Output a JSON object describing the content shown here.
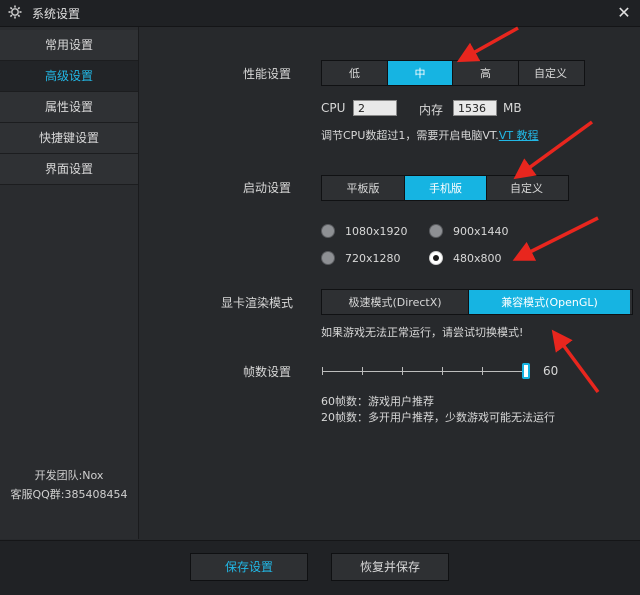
{
  "window": {
    "title": "系统设置",
    "close_glyph": "✕",
    "icon": "gear-icon"
  },
  "sidebar": {
    "items": [
      {
        "label": "常用设置",
        "active": false
      },
      {
        "label": "高级设置",
        "active": true
      },
      {
        "label": "属性设置",
        "active": false
      },
      {
        "label": "快捷键设置",
        "active": false
      },
      {
        "label": "界面设置",
        "active": false
      }
    ],
    "footer": {
      "team": "开发团队:Nox",
      "support": "客服QQ群:385408454"
    }
  },
  "performance": {
    "label": "性能设置",
    "options": [
      "低",
      "中",
      "高",
      "自定义"
    ],
    "selected": "中",
    "cpu_label": "CPU",
    "cpu_value": "2",
    "mem_label": "内存",
    "mem_value": "1536",
    "mem_unit": "MB",
    "hint_prefix": "调节CPU数超过1，需要开启电脑VT.",
    "hint_link": "VT 教程"
  },
  "startup": {
    "label": "启动设置",
    "options": [
      "平板版",
      "手机版",
      "自定义"
    ],
    "selected": "手机版",
    "resolutions": [
      {
        "label": "1080x1920",
        "checked": false
      },
      {
        "label": "900x1440",
        "checked": false
      },
      {
        "label": "720x1280",
        "checked": false
      },
      {
        "label": "480x800",
        "checked": true
      }
    ]
  },
  "render": {
    "label": "显卡渲染模式",
    "options": [
      "极速模式(DirectX)",
      "兼容模式(OpenGL)"
    ],
    "selected": "兼容模式(OpenGL)",
    "hint": "如果游戏无法正常运行，请尝试切换模式!"
  },
  "fps": {
    "label": "帧数设置",
    "value": "60",
    "level": 1.0,
    "note1": "60帧数：游戏用户推荐",
    "note2": "20帧数：多开用户推荐，少数游戏可能无法运行"
  },
  "footer": {
    "save": "保存设置",
    "restore": "恢复并保存"
  },
  "colors": {
    "accent": "#16b4e2",
    "annotation_arrow": "#e8261e"
  }
}
